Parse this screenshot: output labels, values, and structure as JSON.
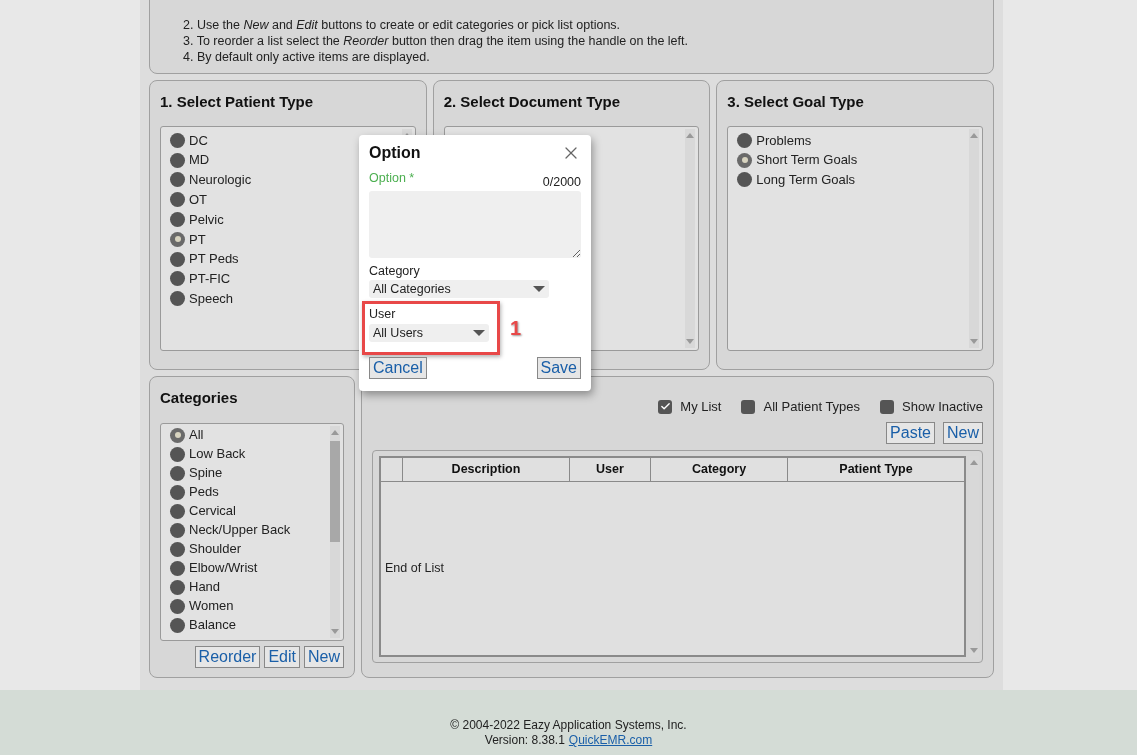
{
  "instructions": [
    "2. Use the *New* and *Edit* buttons to create or edit categories or pick list options.",
    "3. To reorder a list select the *Reorder* button then drag the item using the handle on the left.",
    "4. By default only active items are displayed."
  ],
  "patient_type": {
    "title": "1. Select Patient Type",
    "items": [
      {
        "label": "DC",
        "selected": false
      },
      {
        "label": "MD",
        "selected": false
      },
      {
        "label": "Neurologic",
        "selected": false
      },
      {
        "label": "OT",
        "selected": false
      },
      {
        "label": "Pelvic",
        "selected": false
      },
      {
        "label": "PT",
        "selected": true
      },
      {
        "label": "PT Peds",
        "selected": false
      },
      {
        "label": "PT-FIC",
        "selected": false
      },
      {
        "label": "Speech",
        "selected": false
      }
    ]
  },
  "document_type": {
    "title": "2. Select Document Type"
  },
  "goal_type": {
    "title": "3. Select Goal Type",
    "items": [
      {
        "label": "Problems",
        "selected": false
      },
      {
        "label": "Short Term Goals",
        "selected": true
      },
      {
        "label": "Long Term Goals",
        "selected": false
      }
    ]
  },
  "categories": {
    "title": "Categories",
    "items": [
      {
        "label": "All",
        "selected": true
      },
      {
        "label": "Low Back",
        "selected": false
      },
      {
        "label": "Spine",
        "selected": false
      },
      {
        "label": "Peds",
        "selected": false
      },
      {
        "label": "Cervical",
        "selected": false
      },
      {
        "label": "Neck/Upper Back",
        "selected": false
      },
      {
        "label": "Shoulder",
        "selected": false
      },
      {
        "label": "Elbow/Wrist",
        "selected": false
      },
      {
        "label": "Hand",
        "selected": false
      },
      {
        "label": "Women",
        "selected": false
      },
      {
        "label": "Balance",
        "selected": false
      }
    ],
    "buttons": [
      "Reorder",
      "Edit",
      "New"
    ]
  },
  "options": {
    "filters": [
      {
        "label": "My List",
        "checked": true
      },
      {
        "label": "All Patient Types",
        "checked": false
      },
      {
        "label": "Show Inactive",
        "checked": false
      }
    ],
    "buttons": [
      "Paste",
      "New"
    ],
    "columns": [
      "Description",
      "User",
      "Category",
      "Patient Type"
    ],
    "empty_message": "End of List"
  },
  "dialog": {
    "title": "Option",
    "option_label": "Option *",
    "counter": "0/2000",
    "category_label": "Category",
    "category_value": "All Categories",
    "user_label": "User",
    "user_value": "All Users",
    "cancel": "Cancel",
    "save": "Save",
    "annotation": "1"
  },
  "footer": {
    "copyright": "© 2004-2022 Eazy Application Systems, Inc.",
    "version": "Version: 8.38.1",
    "link": "QuickEMR.com"
  }
}
